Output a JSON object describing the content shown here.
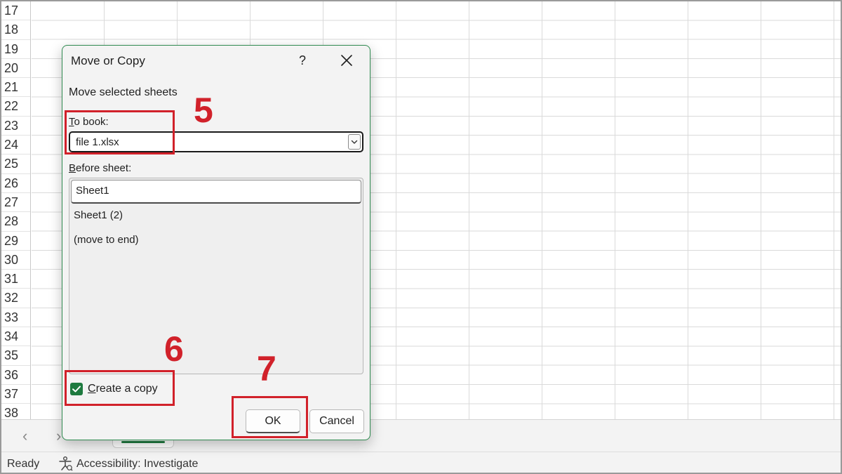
{
  "grid": {
    "row_numbers": [
      "17",
      "18",
      "19",
      "20",
      "21",
      "22",
      "23",
      "24",
      "25",
      "26",
      "27",
      "28",
      "29",
      "30",
      "31",
      "32",
      "33",
      "34",
      "35",
      "36",
      "37",
      "38"
    ]
  },
  "tabs": {
    "prev_icon": "‹",
    "next_icon": "›",
    "add_icon": "(+)"
  },
  "status": {
    "ready": "Ready",
    "accessibility": "Accessibility: Investigate"
  },
  "dialog": {
    "title": "Move or Copy",
    "help": "?",
    "subtitle": "Move selected sheets",
    "to_book_label_key": "T",
    "to_book_label_rest": "o book:",
    "to_book_value": "file 1.xlsx",
    "before_label_key": "B",
    "before_label_rest": "efore sheet:",
    "sheets": [
      "Sheet1",
      "Sheet1 (2)",
      "(move to end)"
    ],
    "selected_sheet": "Sheet1",
    "copy_label_key": "C",
    "copy_label_rest": "reate a copy",
    "copy_checked": true,
    "ok": "OK",
    "cancel": "Cancel"
  },
  "annotations": {
    "step_to_book": "5",
    "step_copy": "6",
    "step_ok": "7",
    "color": "#d1212a"
  },
  "colors": {
    "accent": "#1e7a3f",
    "dialog_border": "#2f8a50"
  }
}
